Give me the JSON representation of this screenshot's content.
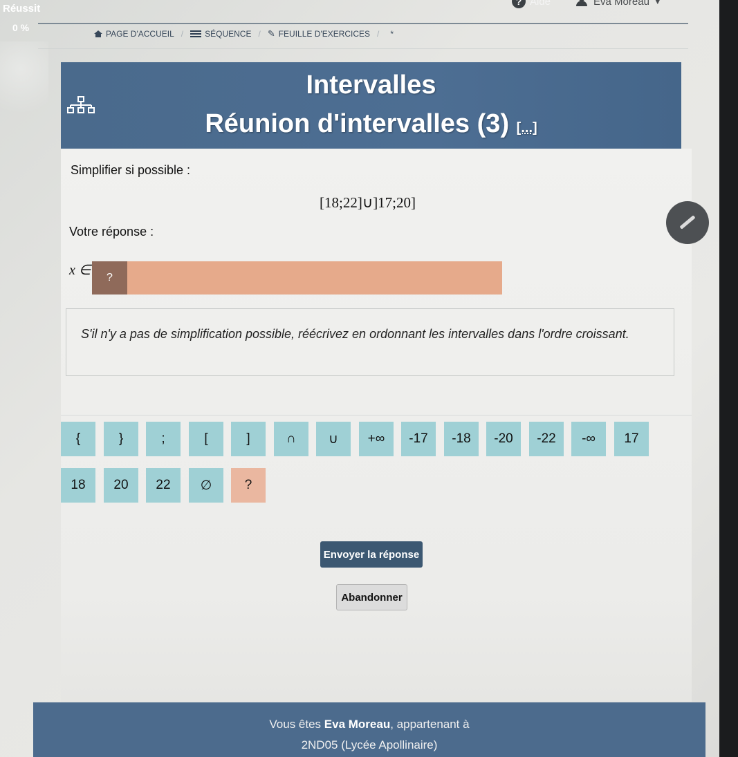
{
  "status": {
    "label": "Réussit",
    "percent": "0 %"
  },
  "topbar": {
    "help_label": "Aide",
    "help_glyph": "?",
    "user_name": "Eva Moreau"
  },
  "breadcrumb": {
    "items": [
      {
        "label": "PAGE D'ACCUEIL",
        "icon": "home-icon"
      },
      {
        "label": "SÉQUENCE",
        "icon": "list-icon"
      },
      {
        "label": "FEUILLE D'EXERCICES",
        "icon": "edit-icon"
      }
    ],
    "star": "*"
  },
  "banner": {
    "title": "Intervalles",
    "subtitle": "Réunion d'intervalles (3)",
    "more": "[...]"
  },
  "exercise": {
    "instruction": "Simplifier si possible :",
    "expression": "[18;22]∪]17;20]",
    "answer_label": "Votre réponse :",
    "x_in": "x ∈",
    "answer_placeholder": "?",
    "hint": "S'il n'y a pas de simplification possible, réécrivez en ordonnant les intervalles dans l'ordre croissant."
  },
  "keypad": {
    "keys": [
      "{",
      "}",
      ";",
      "[",
      "]",
      "∩",
      "∪",
      "+∞",
      "-17",
      "-18",
      "-20",
      "-22",
      "-∞",
      "17",
      "18",
      "20",
      "22",
      "∅",
      "?"
    ]
  },
  "buttons": {
    "send": "Envoyer la réponse",
    "abort": "Abandonner"
  },
  "footer": {
    "prefix": "Vous êtes ",
    "name": "Eva Moreau",
    "suffix": ", appartenant à",
    "group": "2ND05 (Lycée Apollinaire)"
  },
  "colors": {
    "banner": "#4d6e93",
    "key": "#9fd0d5",
    "answer_field": "#e6aa8b",
    "send_button": "#3c5872",
    "footer": "#4c6b8d"
  }
}
